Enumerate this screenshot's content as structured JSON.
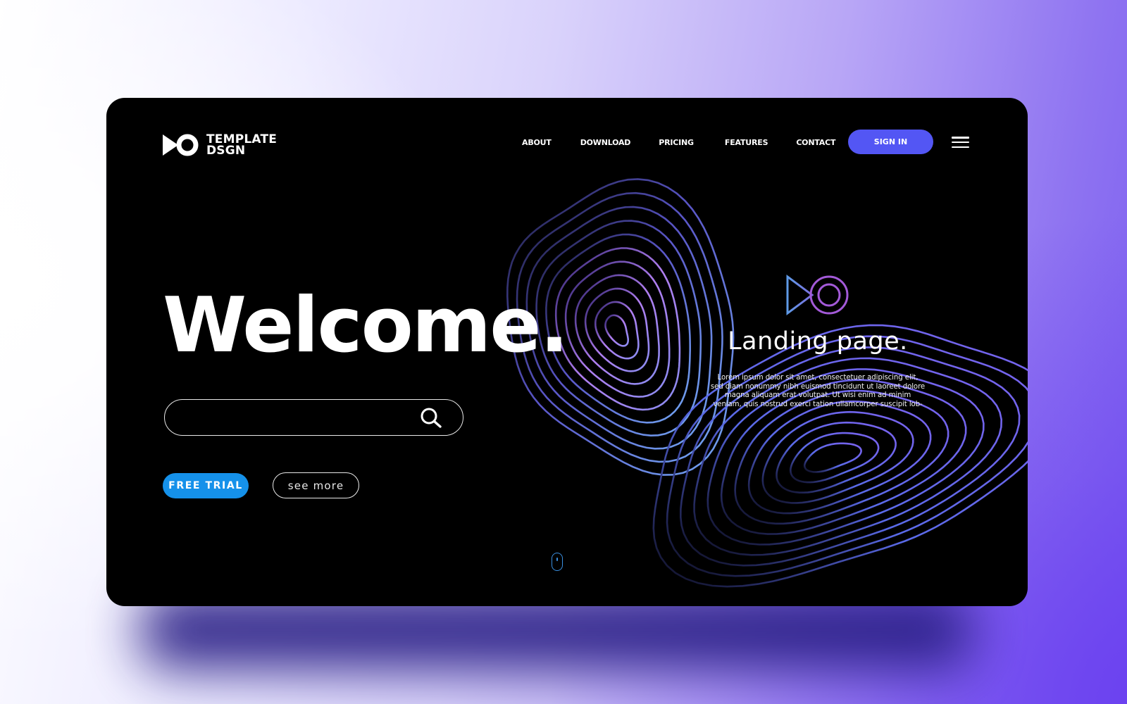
{
  "brand": {
    "name_line1": "TEMPLATE",
    "name_line2": "DSGN",
    "icon": "play-circle-logo-icon"
  },
  "nav": {
    "items": [
      {
        "label": "ABOUT"
      },
      {
        "label": "DOWNLOAD"
      },
      {
        "label": "PRICING"
      },
      {
        "label": "FEATURES"
      },
      {
        "label": "CONTACT"
      }
    ],
    "sign_in_label": "SIGN IN",
    "menu_icon": "hamburger-menu-icon"
  },
  "hero": {
    "title": "Welcome.",
    "search": {
      "value": "",
      "placeholder": "",
      "icon": "search-icon"
    },
    "free_trial_label": "FREE TRIAL",
    "see_more_label": "see more",
    "scroll_icon": "mouse-scroll-icon"
  },
  "feature": {
    "icon": "play-circle-outline-logo-icon",
    "title": "Landing page.",
    "body_lines": [
      "Lorem ipsum dolor sit amet, consectetuer adipiscing elit,",
      "sed diam nonummy nibh euismod tincidunt ut laoreet dolore",
      "magna aliquam erat volutpat. Ut wisi enim ad minim",
      "veniam, quis nostrud exerci tation ullamcorper suscipit lob-"
    ]
  },
  "colors": {
    "card_bg": "#000000",
    "sign_in_bg": "#5356f4",
    "free_trial_bg": "#1591ea",
    "wave_blue": "#6fa3f0",
    "wave_purple": "#b57ef0",
    "wave_violet": "#6a5ee8"
  }
}
